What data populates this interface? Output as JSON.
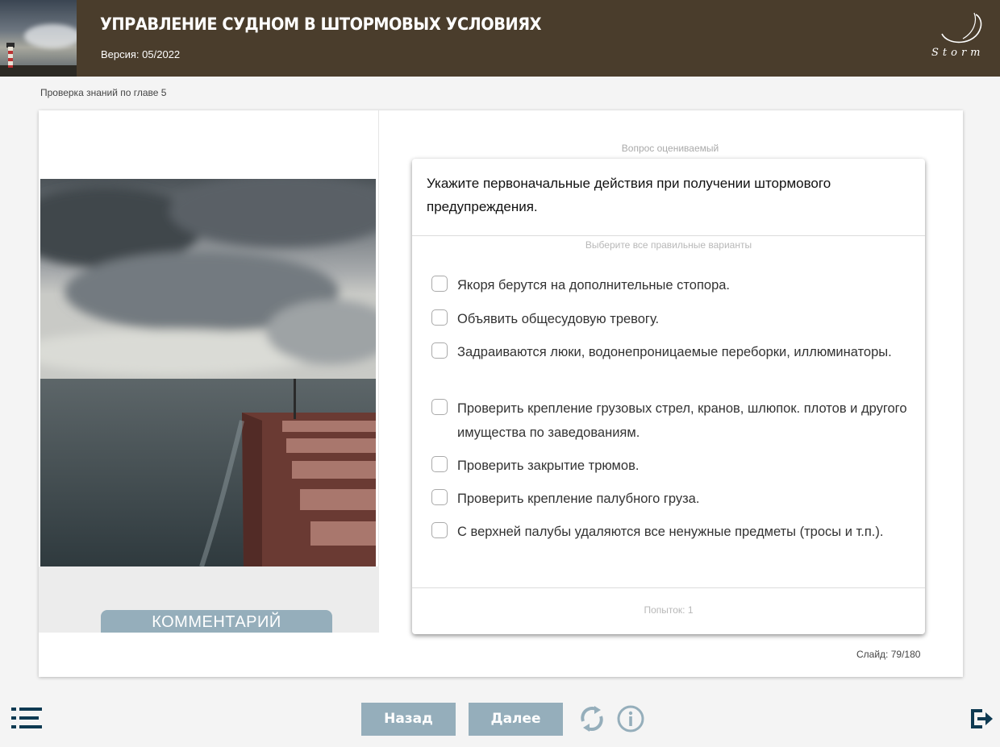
{
  "header": {
    "title": "УПРАВЛЕНИЕ СУДНОМ В ШТОРМОВЫХ УСЛОВИЯХ",
    "version": "Версия: 05/2022",
    "logo_text": "Storm"
  },
  "breadcrumb": "Проверка знаний по главе 5",
  "left_panel": {
    "comment_button": "КОММЕНТАРИЙ"
  },
  "question": {
    "graded_label": "Вопрос оцениваемый",
    "text": "Укажите первоначальные действия при получении штормового предупреждения.",
    "hint": "Выберите все правильные варианты",
    "options": [
      {
        "label": "Якоря берутся на дополнительные стопора.",
        "checked": false
      },
      {
        "label": "Объявить общесудовую тревогу.",
        "checked": false
      },
      {
        "label": "Задраиваются люки, водонепроницаемые переборки, иллюминаторы.",
        "checked": false
      },
      {
        "label": "Проверить крепление грузовых стрел, кранов, шлюпок. плотов и другого имущества по заведованиям.",
        "checked": false
      },
      {
        "label": "Проверить закрытие трюмов.",
        "checked": false
      },
      {
        "label": "Проверить крепление палубного груза.",
        "checked": false
      },
      {
        "label": "С верхней палубы удаляются все ненужные предметы (тросы и т.п.).",
        "checked": false
      }
    ],
    "attempts": "Попыток: 1"
  },
  "slide_counter": "Слайд: 79/180",
  "footer": {
    "back_label": "Назад",
    "next_label": "Далее",
    "icons": [
      "menu-icon",
      "reload-icon",
      "info-icon",
      "exit-icon"
    ]
  },
  "colors": {
    "header_bg": "#4a3d2c",
    "button_bg": "#95aebb",
    "icon_color": "#0e3a52"
  }
}
